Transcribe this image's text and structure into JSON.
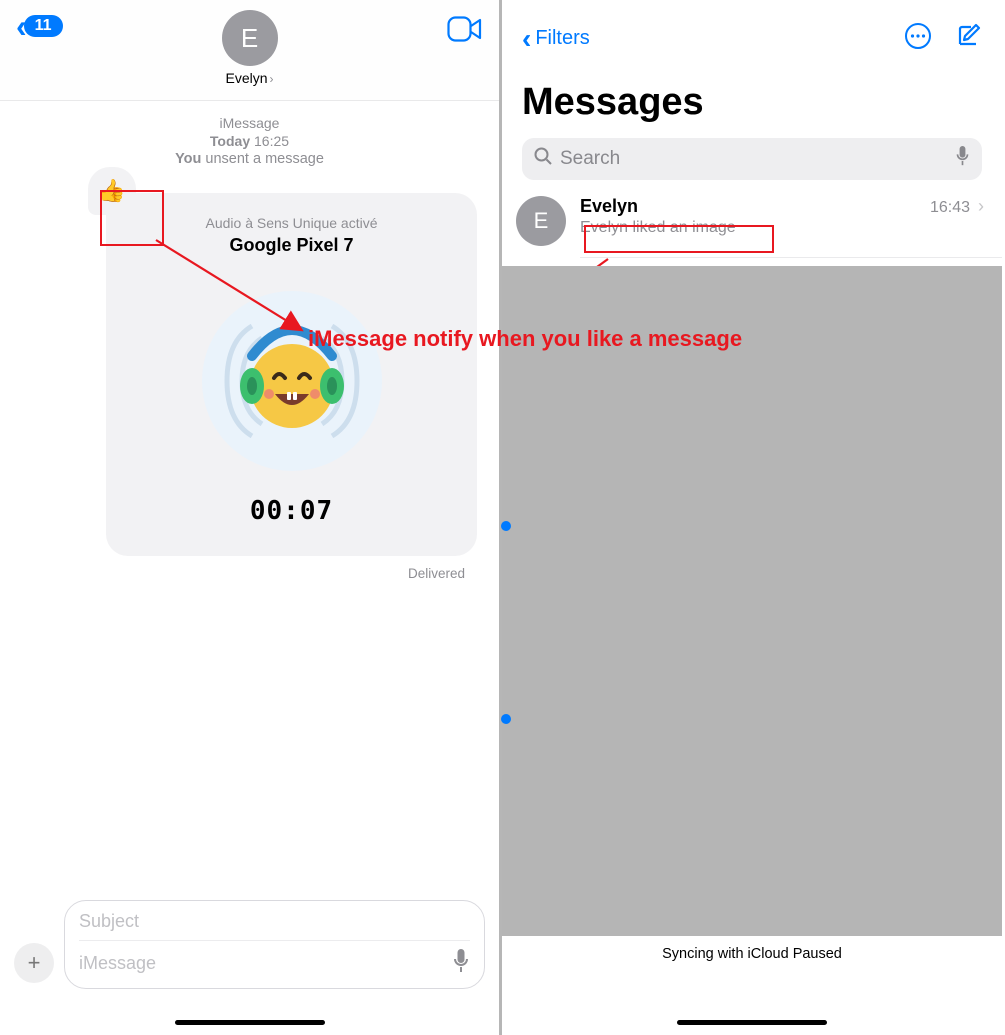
{
  "left": {
    "back_count": "11",
    "contact_initial": "E",
    "contact_name": "Evelyn",
    "service": "iMessage",
    "time_day": "Today",
    "time_hm": "16:25",
    "unsent_prefix": "You",
    "unsent_text": "unsent a message",
    "bubble_subtitle": "Audio à Sens Unique activé",
    "bubble_title": "Google Pixel 7",
    "bubble_timer": "00:07",
    "reaction_emoji": "👍",
    "delivered": "Delivered",
    "subject_placeholder": "Subject",
    "message_placeholder": "iMessage"
  },
  "right": {
    "filters_label": "Filters",
    "title": "Messages",
    "search_placeholder": "Search",
    "rows": [
      {
        "initial": "E",
        "name": "Evelyn",
        "time": "16:43",
        "preview": "Evelyn liked an image"
      }
    ],
    "sync_status": "Syncing with iCloud Paused"
  },
  "annotation": "iMessage notify when you like a message"
}
